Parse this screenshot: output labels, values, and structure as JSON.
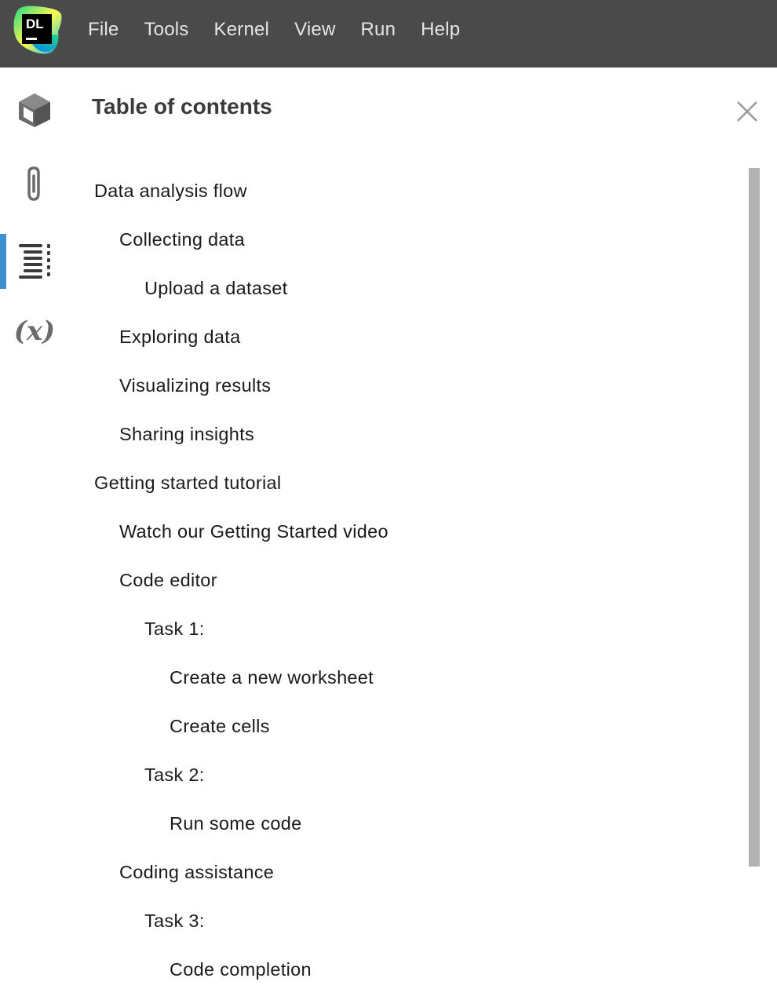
{
  "app": {
    "logo_text": "DL"
  },
  "menu": [
    "File",
    "Tools",
    "Kernel",
    "View",
    "Run",
    "Help"
  ],
  "sidebar": {
    "buttons": [
      {
        "icon": "package-icon"
      },
      {
        "icon": "paperclip-icon"
      },
      {
        "icon": "table-of-contents-icon",
        "active": true
      },
      {
        "icon": "variables-icon",
        "text": "(x)"
      }
    ]
  },
  "panel": {
    "title": "Table of contents"
  },
  "toc": [
    {
      "label": "Data analysis flow",
      "level": 1
    },
    {
      "label": "Collecting data",
      "level": 2
    },
    {
      "label": "Upload a dataset",
      "level": 3
    },
    {
      "label": "Exploring data",
      "level": 2
    },
    {
      "label": "Visualizing results",
      "level": 2
    },
    {
      "label": "Sharing insights",
      "level": 2
    },
    {
      "label": "Getting started tutorial",
      "level": 1
    },
    {
      "label": "Watch our Getting Started video",
      "level": 2
    },
    {
      "label": "Code editor",
      "level": 2
    },
    {
      "label": "Task 1:",
      "level": 3
    },
    {
      "label": "Create a new worksheet",
      "level": 4
    },
    {
      "label": "Create cells",
      "level": 4
    },
    {
      "label": "Task 2:",
      "level": 3
    },
    {
      "label": "Run some code",
      "level": 4
    },
    {
      "label": "Coding assistance",
      "level": 2
    },
    {
      "label": "Task 3:",
      "level": 3
    },
    {
      "label": "Code completion",
      "level": 4
    }
  ],
  "colors": {
    "menubar": "#4a4a4a",
    "active_indicator": "#3d8fd1",
    "scrollbar": "#b3b3b3"
  }
}
